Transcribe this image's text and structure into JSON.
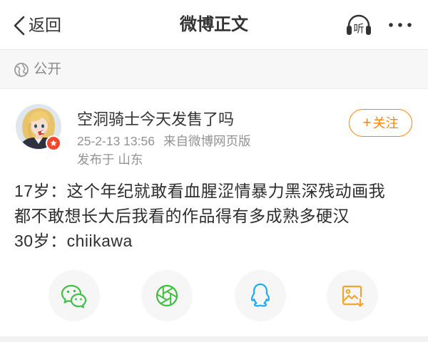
{
  "colors": {
    "brand_orange": "#ff8200",
    "text_primary": "#333333",
    "text_secondary": "#939393",
    "wechat_green": "#40bf49",
    "moments_green": "#3fbf3f",
    "qq_blue": "#20aaf0",
    "image_orange": "#f3a42a",
    "badge_red": "#f5452c"
  },
  "nav": {
    "back_icon": "chevron-left-icon",
    "back_label": "返回",
    "title": "微博正文",
    "listen_icon": "headphones-icon",
    "listen_label": "听",
    "more_icon": "more-dots-icon"
  },
  "visibility": {
    "icon": "globe-icon",
    "label": "公开"
  },
  "post": {
    "author": {
      "name": "空洞骑士今天发售了吗",
      "badge_icon": "verified-badge-icon"
    },
    "time": "25-2-13 13:56",
    "source": "来自微博网页版",
    "location": "发布于 山东",
    "follow": {
      "plus": "+",
      "label": "关注"
    },
    "text_lines": [
      "17岁：这个年纪就敢看血腥涩情暴力黑深残动画我",
      "都不敢想长大后我看的作品得有多成熟多硬汉",
      "30岁：chiikawa"
    ]
  },
  "share": {
    "items": [
      {
        "icon": "wechat-icon"
      },
      {
        "icon": "moments-icon"
      },
      {
        "icon": "qq-icon"
      },
      {
        "icon": "save-image-icon"
      }
    ]
  }
}
